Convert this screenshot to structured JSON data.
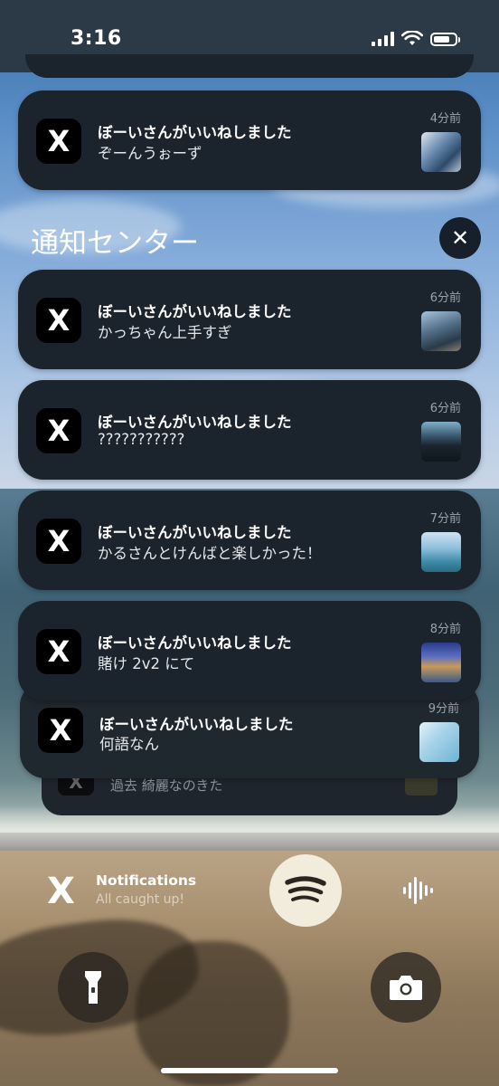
{
  "status_bar": {
    "time": "3:16"
  },
  "top_notification": {
    "app": "X",
    "title": "ぼーいさんがいいねしました",
    "body": "ぞーんうぉーず",
    "age": "4分前"
  },
  "notification_center": {
    "header": "通知センター",
    "close_label": "✕",
    "notifications": [
      {
        "app": "X",
        "title": "ぼーいさんがいいねしました",
        "body": "かっちゃん上手すぎ",
        "age": "6分前"
      },
      {
        "app": "X",
        "title": "ぼーいさんがいいねしました",
        "body": "???????????",
        "age": "6分前"
      },
      {
        "app": "X",
        "title": "ぼーいさんがいいねしました",
        "body": "かるさんとけんばと楽しかった！",
        "age": "7分前"
      },
      {
        "app": "X",
        "title": "ぼーいさんがいいねしました",
        "body": "賭け 2v2 にて",
        "age": "8分前"
      },
      {
        "app": "X",
        "title": "ぼーいさんがいいねしました",
        "body": "何語なん",
        "age": "9分前"
      }
    ],
    "stacked_back_text": "過去 綺麗なのきた"
  },
  "now_playing": {
    "app_icon": "X",
    "title": "Notifications",
    "subtitle": "All caught up!"
  },
  "icons": {
    "spotify": "spotify-icon",
    "waveform": "waveform-icon",
    "flashlight": "flashlight-icon",
    "camera": "camera-icon"
  }
}
